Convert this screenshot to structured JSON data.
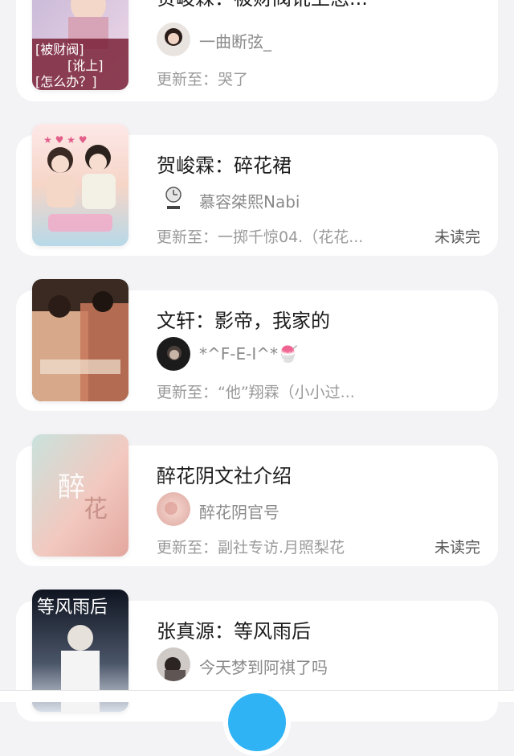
{
  "books": [
    {
      "title": "贺峻霖：被财阀讹上怎...",
      "author": "一曲断弦_",
      "update": "更新至：哭了",
      "unread": "",
      "cover_text": [
        "[被财阀]",
        "[讹上]",
        "[怎么办？]"
      ],
      "cover_colors": [
        "#c8b8d8",
        "#f0d9e8",
        "#7a2238"
      ]
    },
    {
      "title": "贺峻霖：碎花裙",
      "author": "慕容桀熙Nabi",
      "update": "更新至：一掷千惊04.（花花...",
      "unread": "未读完",
      "cover_text": [],
      "cover_colors": [
        "#fde8e8",
        "#f6d5c7",
        "#b7d9e8"
      ]
    },
    {
      "title": "文轩：影帝，我家的",
      "author": "*^F-E-I^*🍧",
      "update": "更新至：“他”翔霖（小小过...",
      "unread": "",
      "cover_text": [],
      "cover_colors": [
        "#3a2a22",
        "#d7a98a",
        "#c9785a"
      ]
    },
    {
      "title": "醉花阴文社介绍",
      "author": "醉花阴官号",
      "update": "更新至：副社专访.月照梨花",
      "unread": "未读完",
      "cover_text": [
        "醉",
        "花"
      ],
      "cover_colors": [
        "#c9e2dc",
        "#f2c9c0",
        "#e3a79e"
      ]
    },
    {
      "title": "张真源：等风雨后",
      "author": "今天梦到阿祺了吗",
      "update": "",
      "unread": "",
      "cover_text": [
        "等风雨后"
      ],
      "cover_colors": [
        "#0f1420",
        "#4a5568",
        "#d9dfe8"
      ]
    }
  ],
  "fab_color": "#2fb3f5"
}
